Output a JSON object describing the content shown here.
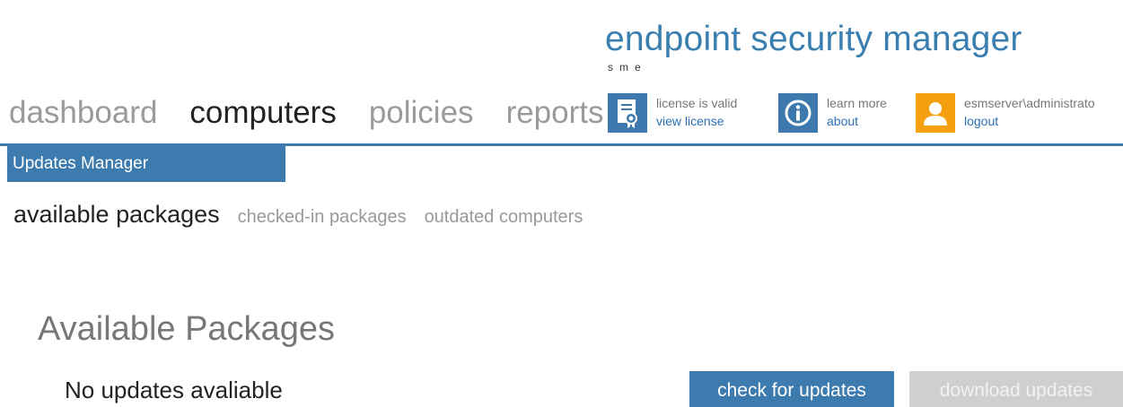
{
  "brand": {
    "title": "endpoint security manager",
    "subtitle": "sme"
  },
  "nav": {
    "items": [
      {
        "label": "dashboard",
        "active": false
      },
      {
        "label": "computers",
        "active": true
      },
      {
        "label": "policies",
        "active": false
      },
      {
        "label": "reports",
        "active": false
      }
    ]
  },
  "license": {
    "icon": "certificate-icon",
    "status": "license is valid",
    "link": "view license"
  },
  "help": {
    "icon": "info-icon",
    "text": "learn more",
    "link": "about"
  },
  "user": {
    "icon": "user-icon",
    "name": "esmserver\\administrato",
    "link": "logout"
  },
  "section": {
    "title": "Updates Manager"
  },
  "subnav": {
    "items": [
      {
        "label": "available packages",
        "active": true
      },
      {
        "label": "checked-in packages",
        "active": false
      },
      {
        "label": "outdated computers",
        "active": false
      }
    ]
  },
  "content": {
    "title": "Available Packages",
    "empty_message": "No updates avaliable"
  },
  "actions": {
    "check_label": "check for updates",
    "download_label": "download updates"
  },
  "colors": {
    "accent": "#3d7aae",
    "brand_text": "#3a7fb0",
    "user_icon": "#f5a011",
    "disabled_button": "#cfcfcf"
  }
}
